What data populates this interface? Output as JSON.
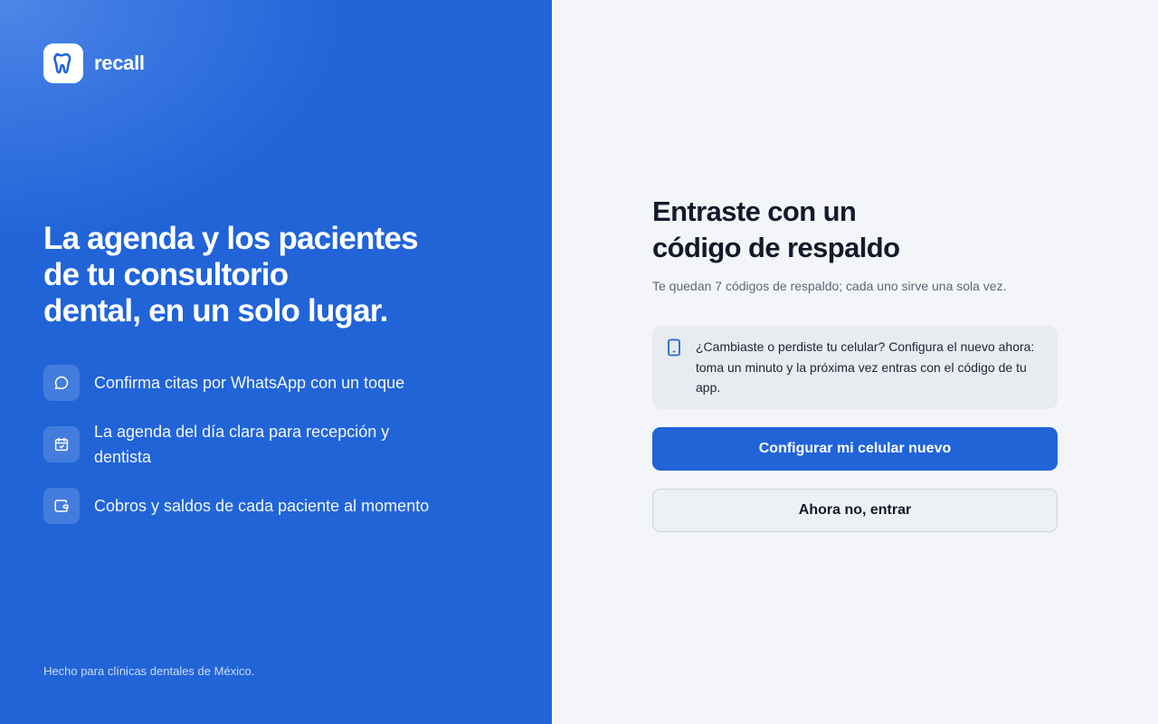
{
  "brand": {
    "name": "recall",
    "logo_icon": "tooth-icon"
  },
  "hero": {
    "headline_lines": [
      "La agenda y los pacientes",
      "de tu consultorio",
      "dental, en un solo lugar."
    ]
  },
  "features": [
    {
      "icon": "chat-bubble-icon",
      "text": "Confirma citas por WhatsApp con un toque"
    },
    {
      "icon": "calendar-check-icon",
      "text": "La agenda del día clara para recepción y dentista"
    },
    {
      "icon": "wallet-icon",
      "text": "Cobros y saldos de cada paciente al momento"
    }
  ],
  "footer_note": "Hecho para clínicas dentales de México.",
  "panel": {
    "title_lines": [
      "Entraste con un",
      "código de respaldo"
    ],
    "subtitle": "Te quedan 7 códigos de respaldo; cada uno sirve una sola vez.",
    "notice": {
      "icon": "smartphone-icon",
      "text": "¿Cambiaste o perdiste tu celular? Configura el nuevo ahora: toma un minuto y la próxima vez entras con el código de tu app."
    },
    "primary_button": "Configurar mi celular nuevo",
    "secondary_button": "Ahora no, entrar"
  },
  "colors": {
    "brand_blue": "#2164d8",
    "panel_bg": "#f3f5f8",
    "notice_bg": "#e8ecf1",
    "text_dark": "#121a2b"
  }
}
